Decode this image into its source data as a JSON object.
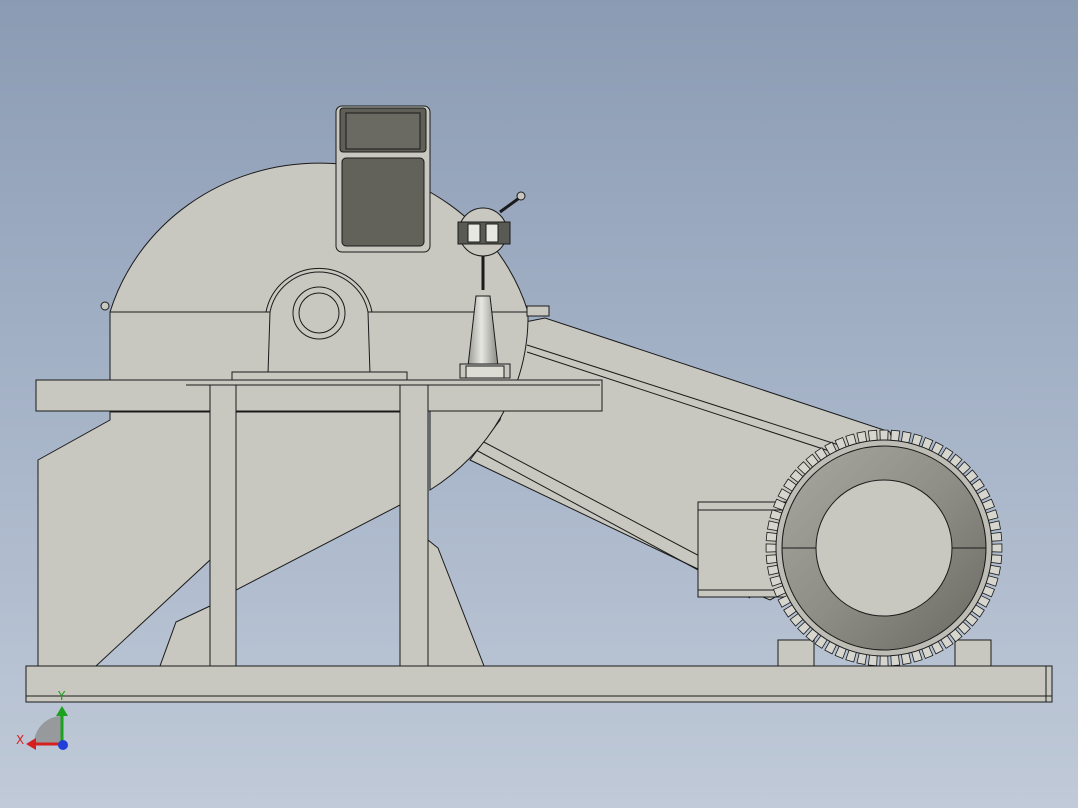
{
  "view": {
    "background_top": "#8b9bb3",
    "background_bottom": "#c0cad8",
    "part_fill": "#c8c8c0",
    "edge_color": "#1a1a1a"
  },
  "triad": {
    "x_label": "X",
    "y_label": "Y",
    "x_color": "#d62020",
    "y_color": "#1ca21c",
    "z_color": "#1f3fd8"
  }
}
